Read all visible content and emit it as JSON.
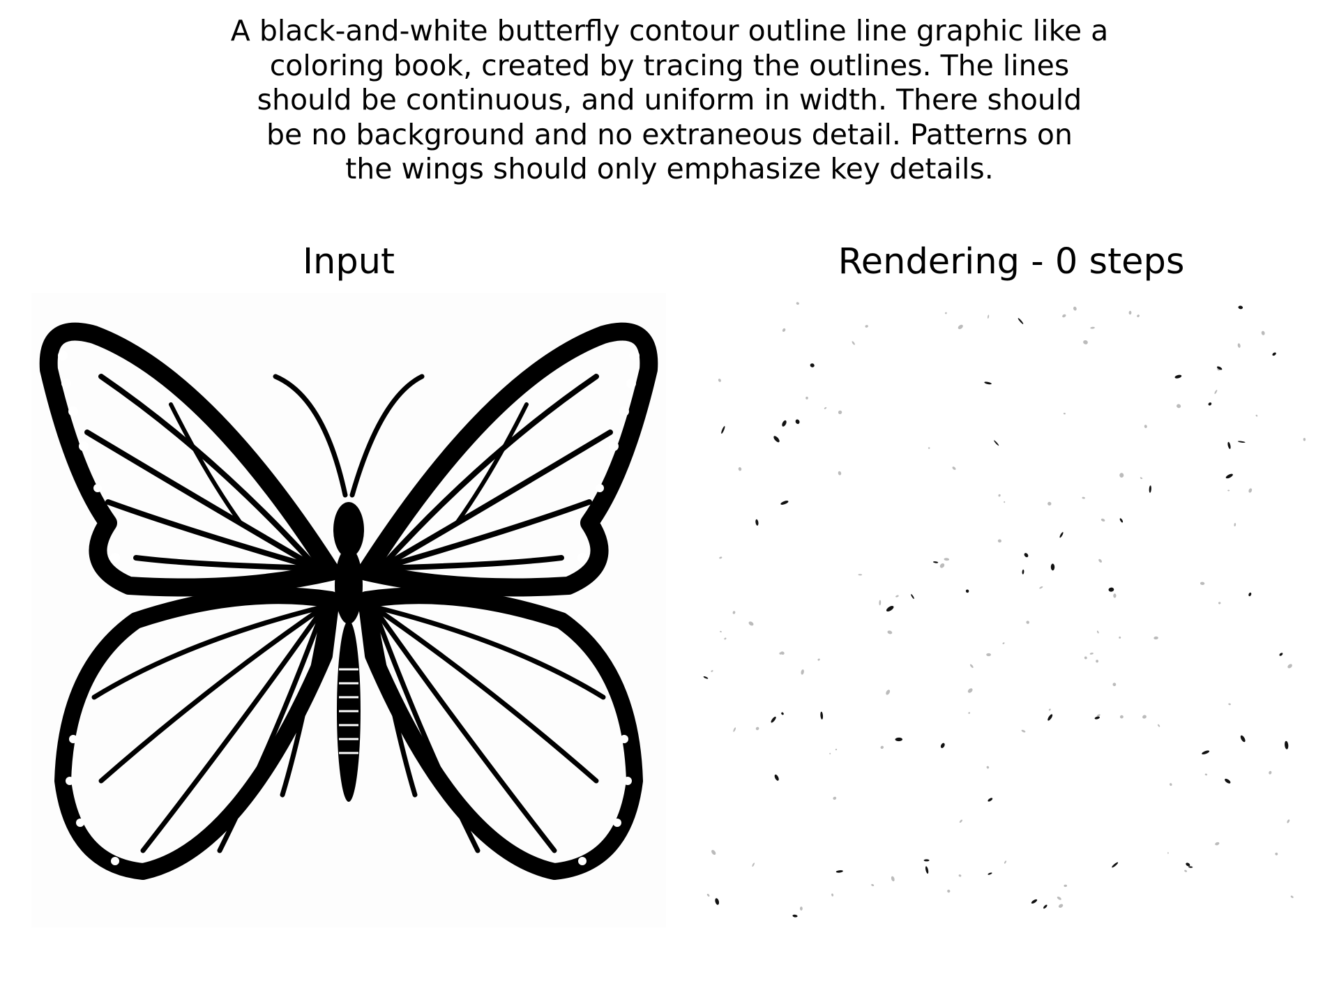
{
  "prompt": {
    "lines": [
      "A black-and-white butterfly contour outline line graphic like a",
      "coloring book, created by tracing the outlines. The lines",
      "should be continuous, and uniform in width. There should",
      "be no background and no extraneous detail. Patterns on",
      "the wings should only emphasize key details."
    ]
  },
  "panels": {
    "input_title": "Input",
    "render_title": "Rendering - 0 steps"
  },
  "colors": {
    "ink": "#000000",
    "paper": "#ffffff"
  }
}
